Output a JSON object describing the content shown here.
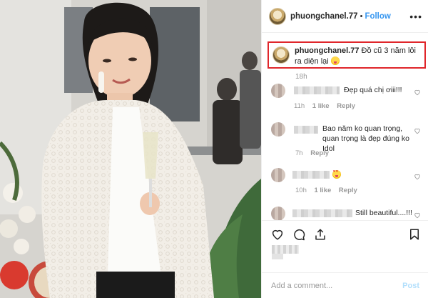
{
  "post": {
    "username": "phuongchanel.77",
    "follow_label": "Follow",
    "separator": "•",
    "more_label": "•••",
    "caption_user": "phuongchanel.77",
    "caption_text": "Đồ cũ 3 năm lôi ra diện lại",
    "caption_emoji": "winking-tongue-emoji",
    "caption_time": "18h"
  },
  "comments": [
    {
      "text": "Đẹp quá chị ơiii!!!",
      "time": "11h",
      "likes": "1 like",
      "reply": "Reply"
    },
    {
      "text": "Bao năm ko quan trọng, quan trọng là đẹp đúng ko Idol",
      "time": "7h",
      "reply": "Reply"
    },
    {
      "emoji": "heart-eyes-emoji",
      "time": "10h",
      "likes": "1 like",
      "reply": "Reply"
    },
    {
      "text": "Still beautiful....!!!"
    }
  ],
  "actions": {
    "like_icon": "heart-icon",
    "comment_icon": "comment-icon",
    "share_icon": "share-icon",
    "save_icon": "bookmark-icon"
  },
  "add_comment": {
    "placeholder": "Add a comment...",
    "post_label": "Post"
  },
  "colors": {
    "follow_blue": "#3897f0",
    "highlight_red": "#e0262b",
    "muted_gray": "#999999",
    "post_disabled": "#b2dffc"
  }
}
